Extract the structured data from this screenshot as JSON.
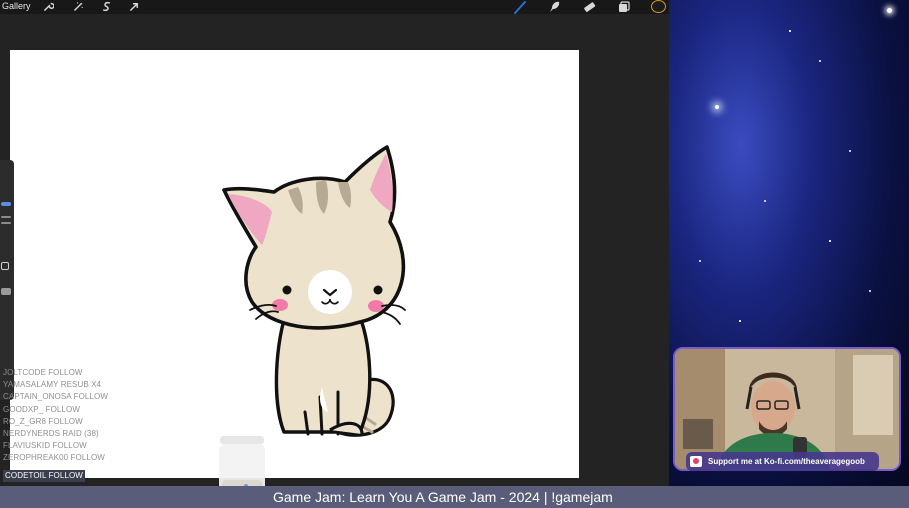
{
  "toolbar": {
    "gallery_label": "Gallery",
    "left_icons": [
      "wrench-icon",
      "magic-wand-icon",
      "selection-icon",
      "transform-icon"
    ],
    "right_icons": [
      "brush-icon",
      "smudge-icon",
      "eraser-icon",
      "layers-icon",
      "color-picker-icon"
    ],
    "active_brush_color": "#2b6fd6",
    "color_ring": "#d39b2a"
  },
  "event_feed": [
    {
      "text": "JOLTCODE  FOLLOW"
    },
    {
      "text": "YAMASALAMY  RESUB X4"
    },
    {
      "text": "CAPTAIN_ONOSA  FOLLOW"
    },
    {
      "text": "GOODXP_  FOLLOW"
    },
    {
      "text": "RO_Z_GR8  FOLLOW"
    },
    {
      "text": "NERDYNERDS  RAID (38)"
    },
    {
      "text": "FLAVIUSKID  FOLLOW"
    },
    {
      "text": "ZEROPHREAK00  FOLLOW"
    },
    {
      "text": "CODETOIL  FOLLOW"
    }
  ],
  "kofi_banner": "Support me at Ko-fi.com/theaveragegoob",
  "stream_title": "Game Jam: Learn You A Game Jam - 2024 | !gamejam",
  "colors": {
    "canvas": "#ffffff",
    "app_bg": "#232323",
    "title_bar": "#5a5d79",
    "cat_fill": "#ede3cc",
    "cat_ear": "#f0a7c1",
    "cat_stripe": "#b7aa95",
    "cheek": "#f27aa8"
  }
}
